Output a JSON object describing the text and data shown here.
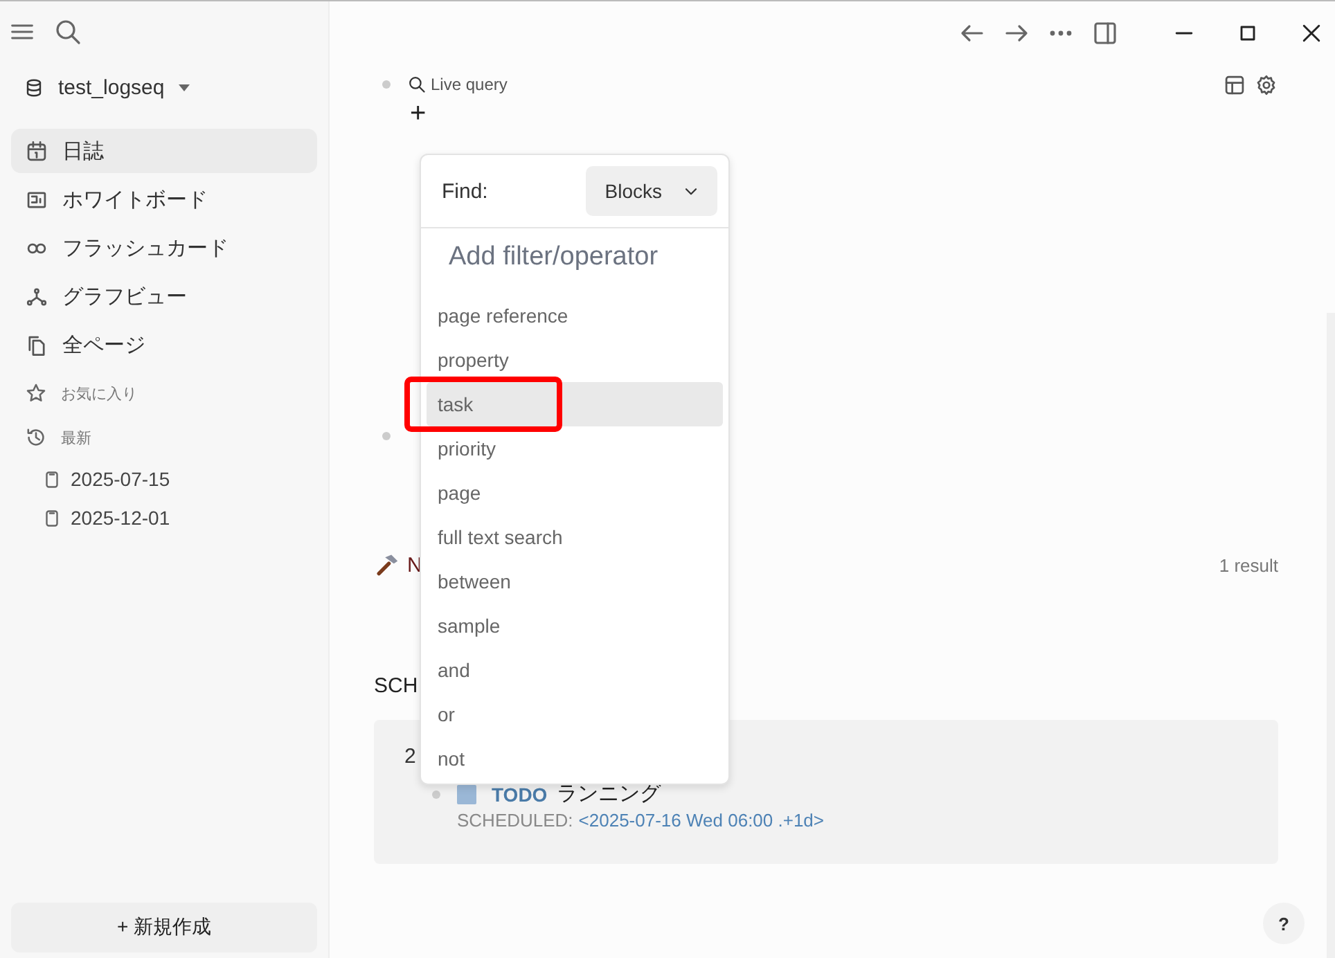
{
  "sidebar": {
    "graph_name": "test_logseq",
    "nav": [
      {
        "label": "日誌",
        "kind": "journal",
        "selected": true
      },
      {
        "label": "ホワイトボード",
        "kind": "whiteboard",
        "selected": false
      },
      {
        "label": "フラッシュカード",
        "kind": "flashcard",
        "selected": false
      },
      {
        "label": "グラフビュー",
        "kind": "graph",
        "selected": false
      },
      {
        "label": "全ページ",
        "kind": "pages",
        "selected": false
      }
    ],
    "sections": [
      {
        "label": "お気に入り",
        "kind": "favorites"
      },
      {
        "label": "最新",
        "kind": "recent"
      }
    ],
    "recent": [
      {
        "label": "2025-07-15"
      },
      {
        "label": "2025-12-01"
      }
    ],
    "new_button": "+ 新規作成"
  },
  "main": {
    "query_title": "Live query",
    "add": "+",
    "block_title": "N",
    "result_count": "1 result",
    "section_heading": "SCH",
    "group_label": "2",
    "task": {
      "marker": "TODO",
      "checked": false,
      "text": "ランニング",
      "scheduled_label": "SCHEDULED:",
      "scheduled_value": "<2025-07-16 Wed 06:00 .+1d>"
    }
  },
  "popup": {
    "find_label": "Find:",
    "find_value": "Blocks",
    "heading": "Add filter/operator",
    "items": [
      {
        "label": "page reference",
        "selected": false,
        "marked": false
      },
      {
        "label": "property",
        "selected": false,
        "marked": false
      },
      {
        "label": "task",
        "selected": true,
        "marked": true
      },
      {
        "label": "priority",
        "selected": false,
        "marked": false
      },
      {
        "label": "page",
        "selected": false,
        "marked": false
      },
      {
        "label": "full text search",
        "selected": false,
        "marked": false
      },
      {
        "label": "between",
        "selected": false,
        "marked": false
      },
      {
        "label": "sample",
        "selected": false,
        "marked": false
      },
      {
        "label": "and",
        "selected": false,
        "marked": false
      },
      {
        "label": "or",
        "selected": false,
        "marked": false
      },
      {
        "label": "not",
        "selected": false,
        "marked": false
      }
    ]
  },
  "help": "?"
}
